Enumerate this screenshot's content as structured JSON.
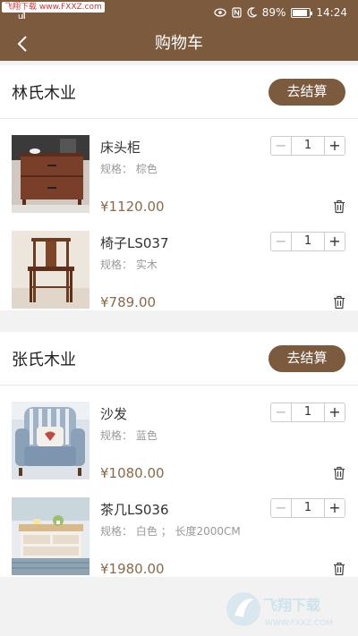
{
  "status_bar": {
    "url_badge": "飞翔下载 www.FXXZ.com",
    "signal_text": "ull",
    "battery": "89%",
    "battery_level": 0.89,
    "time": "14:24"
  },
  "nav": {
    "title": "购物车"
  },
  "shops": [
    {
      "name": "林氏木业",
      "checkout_label": "去结算",
      "items": [
        {
          "name": "床头柜",
          "spec": "规格：  棕色",
          "price": "¥1120.00",
          "qty": "1",
          "image": "nightstand"
        },
        {
          "name": "椅子LS037",
          "spec": "规格：  实木",
          "price": "¥789.00",
          "qty": "1",
          "image": "chair"
        }
      ]
    },
    {
      "name": "张氏木业",
      "checkout_label": "去结算",
      "items": [
        {
          "name": "沙发",
          "spec": "规格：  蓝色",
          "price": "¥1080.00",
          "qty": "1",
          "image": "armchair"
        },
        {
          "name": "茶几LS036",
          "spec": "规格：  白色 ；  长度2000CM",
          "price": "¥1980.00",
          "qty": "1",
          "image": "coffee-table"
        }
      ]
    }
  ],
  "stepper": {
    "minus": "−",
    "plus": "+"
  },
  "watermark": {
    "text_cn": "飞翔下载",
    "text_url": "WWW.FXXZ.COM"
  },
  "colors": {
    "brand_brown": "#7b5a3e",
    "price_brown": "#8b6a4a"
  }
}
